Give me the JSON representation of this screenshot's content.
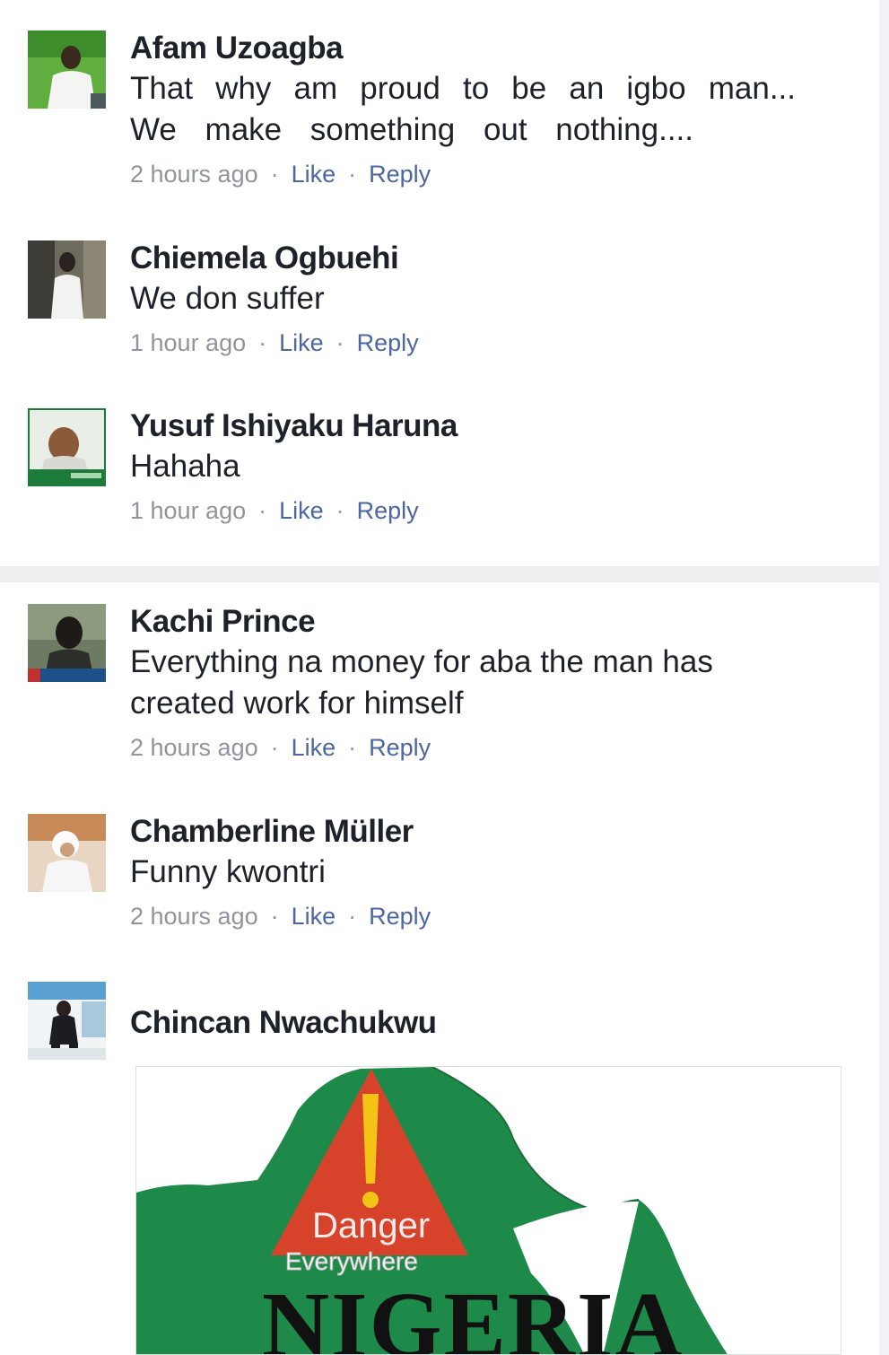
{
  "comments": [
    {
      "author": "Afam Uzoagba",
      "text_lines": [
        "That why am proud to be an igbo man...",
        "We make something out nothing...."
      ],
      "time": "2 hours ago",
      "like": "Like",
      "reply": "Reply"
    },
    {
      "author": "Chiemela Ogbuehi",
      "text": "We don suffer",
      "time": "1 hour ago",
      "like": "Like",
      "reply": "Reply"
    },
    {
      "author": "Yusuf Ishiyaku Haruna",
      "text": "Hahaha",
      "time": "1 hour ago",
      "like": "Like",
      "reply": "Reply"
    },
    {
      "author": "Kachi Prince",
      "text_lines": [
        "Everything na money for aba the man has",
        "created work for himself"
      ],
      "time": "2 hours ago",
      "like": "Like",
      "reply": "Reply"
    },
    {
      "author": "Chamberline Müller",
      "text": "Funny kwontri",
      "time": "2 hours ago",
      "like": "Like",
      "reply": "Reply"
    },
    {
      "author": "Chincan Nwachukwu",
      "attachment": {
        "text_danger": "Danger",
        "text_everywhere": "Everywhere",
        "text_country": "NIGERIA"
      }
    }
  ],
  "colors": {
    "author": "#1d2129",
    "meta": "#90949c",
    "link": "#4b66a1",
    "map_green": "#1e8a4a",
    "warning_red": "#d6432a",
    "warning_yellow": "#f3c316"
  },
  "icons": [
    "avatar-photo",
    "dot-separator",
    "warning-triangle",
    "nigeria-map"
  ]
}
